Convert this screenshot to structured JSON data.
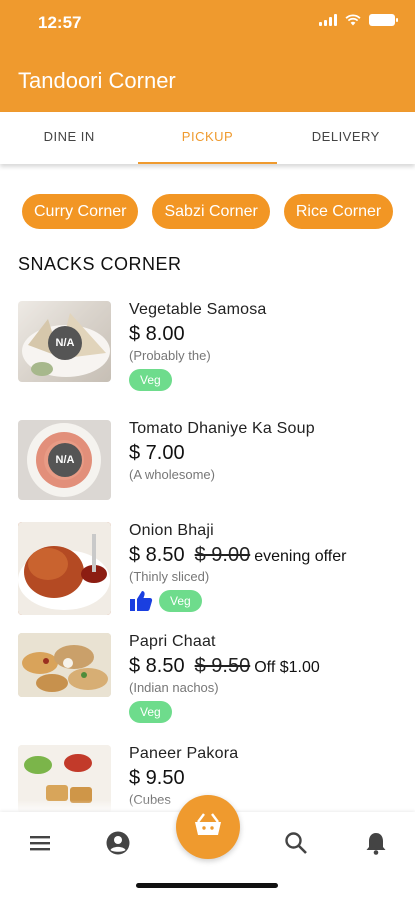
{
  "status_bar": {
    "time": "12:57"
  },
  "app": {
    "title": "Tandoori Corner"
  },
  "tabs": [
    {
      "label": "DINE IN",
      "active": false
    },
    {
      "label": "PICKUP",
      "active": true
    },
    {
      "label": "DELIVERY",
      "active": false
    }
  ],
  "categories": [
    "Curry Corner",
    "Sabzi Corner",
    "Rice Corner"
  ],
  "section": {
    "title": "SNACKS CORNER"
  },
  "items": [
    {
      "name": "Vegetable Samosa",
      "price": "$ 8.00",
      "description": "(Probably the)",
      "veg_label": "Veg",
      "image_badge": "N/A"
    },
    {
      "name": "Tomato Dhaniye Ka Soup",
      "price": "$ 7.00",
      "description": "(A wholesome)",
      "image_badge": "N/A"
    },
    {
      "name": "Onion Bhaji",
      "price": "$ 8.50",
      "old_price": "$ 9.00",
      "offer": "evening offer",
      "description": "(Thinly sliced)",
      "veg_label": "Veg"
    },
    {
      "name": "Papri Chaat",
      "price": "$ 8.50",
      "old_price": "$ 9.50",
      "offer": "Off $1.00",
      "description": "(Indian nachos)",
      "veg_label": "Veg"
    },
    {
      "name": "Paneer Pakora",
      "price": "$ 9.50",
      "description": "(Cubes"
    }
  ],
  "colors": {
    "accent": "#ef9a2e",
    "veg": "#6edc8c",
    "like": "#1a3fe0"
  },
  "icons": {
    "nav": [
      "menu-icon",
      "account-icon",
      "basket-icon",
      "search-icon",
      "bell-icon"
    ],
    "like": "thumbs-up-icon"
  }
}
